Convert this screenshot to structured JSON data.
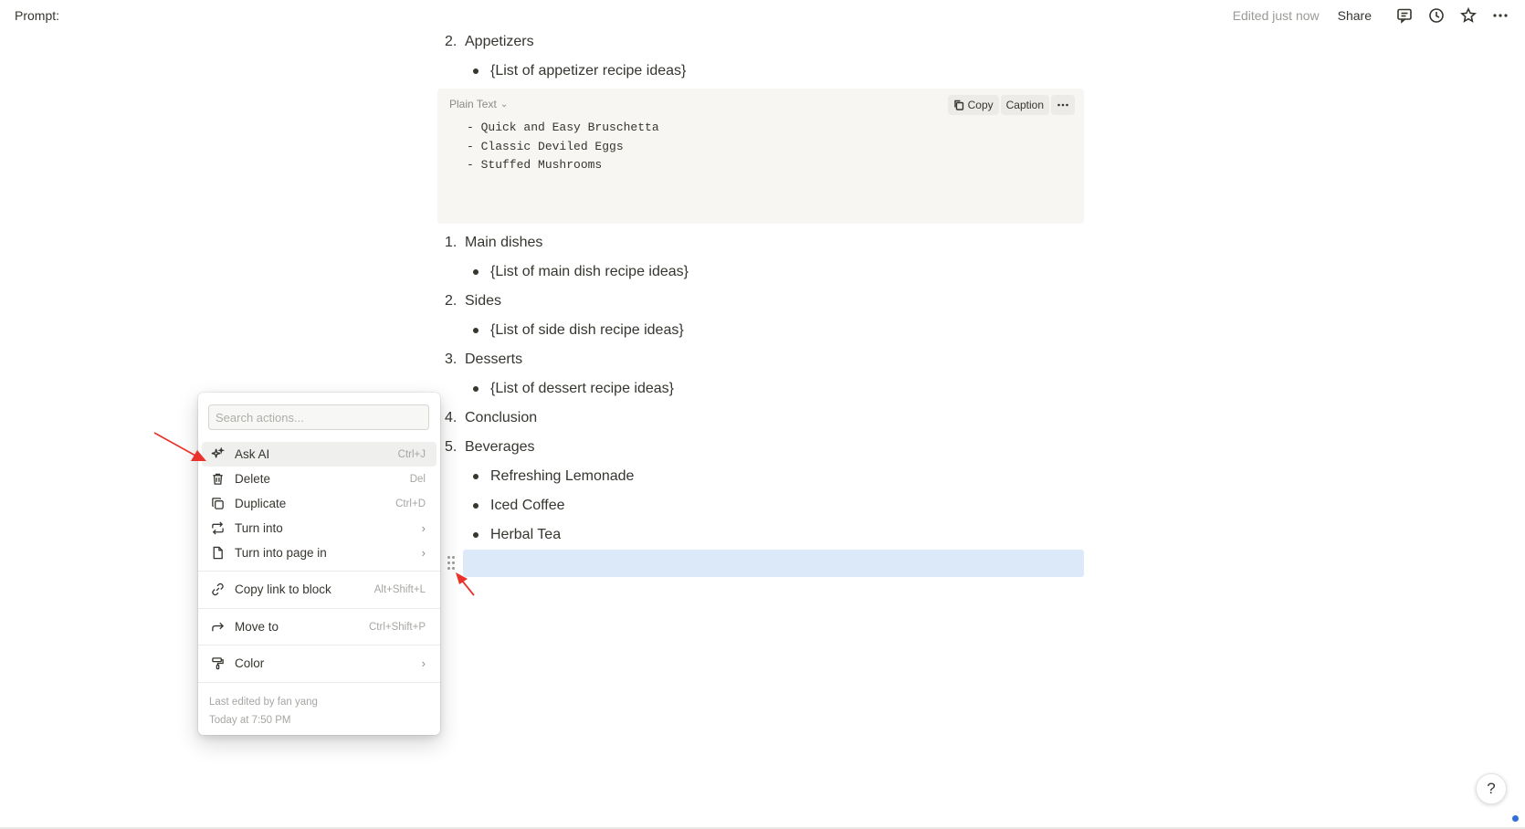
{
  "topbar": {
    "title": "Prompt:",
    "edited": "Edited just now",
    "share": "Share",
    "icons": [
      "comment-icon",
      "history-icon",
      "star-icon",
      "more-icon"
    ]
  },
  "doc": {
    "upper": [
      {
        "kind": "ol",
        "num": "2.",
        "text": "Appetizers"
      },
      {
        "kind": "ul",
        "text": "{List of appetizer recipe ideas}"
      }
    ],
    "code": {
      "language": "Plain Text",
      "copy": "Copy",
      "caption": "Caption",
      "lines": [
        "- Quick and Easy Bruschetta",
        "- Classic Deviled Eggs",
        "- Stuffed Mushrooms"
      ]
    },
    "lower": [
      {
        "kind": "ol",
        "num": "1.",
        "text": "Main dishes"
      },
      {
        "kind": "ul",
        "text": "{List of main dish recipe ideas}"
      },
      {
        "kind": "ol",
        "num": "2.",
        "text": "Sides"
      },
      {
        "kind": "ul",
        "text": "{List of side dish recipe ideas}"
      },
      {
        "kind": "ol",
        "num": "3.",
        "text": "Desserts"
      },
      {
        "kind": "ul",
        "text": "{List of dessert recipe ideas}"
      },
      {
        "kind": "ol",
        "num": "4.",
        "text": "Conclusion"
      },
      {
        "kind": "ol",
        "num": "5.",
        "text": "Beverages"
      },
      {
        "kind": "ul",
        "text": "Refreshing Lemonade"
      },
      {
        "kind": "ul",
        "text": "Iced Coffee"
      },
      {
        "kind": "ul",
        "text": "Herbal Tea"
      }
    ]
  },
  "menu": {
    "search_placeholder": "Search actions...",
    "items": [
      {
        "label": "Ask AI",
        "shortcut": "Ctrl+J",
        "icon": "sparkle-icon"
      },
      {
        "label": "Delete",
        "shortcut": "Del",
        "icon": "trash-icon"
      },
      {
        "label": "Duplicate",
        "shortcut": "Ctrl+D",
        "icon": "duplicate-icon"
      },
      {
        "label": "Turn into",
        "shortcut": "",
        "icon": "turn-into-icon"
      },
      {
        "label": "Turn into page in",
        "shortcut": "",
        "icon": "page-icon"
      },
      {
        "label": "Copy link to block",
        "shortcut": "Alt+Shift+L",
        "icon": "link-icon"
      },
      {
        "label": "Move to",
        "shortcut": "Ctrl+Shift+P",
        "icon": "move-arrow-icon"
      },
      {
        "label": "Color",
        "shortcut": "",
        "icon": "paint-roller-icon"
      }
    ],
    "footer": {
      "edited_by": "Last edited by fan yang",
      "edited_at": "Today at 7:50 PM"
    }
  },
  "help": "?",
  "colors": {
    "text": "#37352f",
    "muted": "#9b9a97",
    "code_bg": "#f7f6f3",
    "selection": "#dbe9f9",
    "annotation_arrow": "#e8322b"
  }
}
